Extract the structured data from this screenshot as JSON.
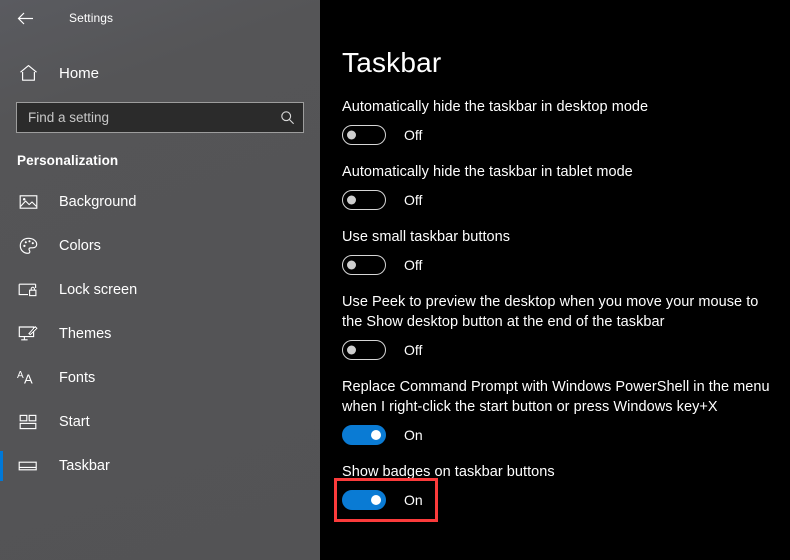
{
  "window": {
    "title": "Settings",
    "back_icon": "back-arrow-icon"
  },
  "sidebar": {
    "home": {
      "label": "Home",
      "icon": "home-icon"
    },
    "search": {
      "placeholder": "Find a setting",
      "value": "",
      "icon": "search-icon"
    },
    "section_heading": "Personalization",
    "accent_color": "#0078d7",
    "items": [
      {
        "label": "Background",
        "icon": "image-icon",
        "selected": false
      },
      {
        "label": "Colors",
        "icon": "palette-icon",
        "selected": false
      },
      {
        "label": "Lock screen",
        "icon": "lock-screen-icon",
        "selected": false
      },
      {
        "label": "Themes",
        "icon": "themes-icon",
        "selected": false
      },
      {
        "label": "Fonts",
        "icon": "fonts-icon",
        "selected": false
      },
      {
        "label": "Start",
        "icon": "start-tiles-icon",
        "selected": false
      },
      {
        "label": "Taskbar",
        "icon": "taskbar-icon",
        "selected": true
      }
    ]
  },
  "main": {
    "title": "Taskbar",
    "toggle_on_color": "#0a7bd4",
    "highlight_color": "#fb3b3b",
    "settings": [
      {
        "label": "Automatically hide the taskbar in desktop mode",
        "state": "Off",
        "on": false,
        "highlighted": false
      },
      {
        "label": "Automatically hide the taskbar in tablet mode",
        "state": "Off",
        "on": false,
        "highlighted": false
      },
      {
        "label": "Use small taskbar buttons",
        "state": "Off",
        "on": false,
        "highlighted": false
      },
      {
        "label": "Use Peek to preview the desktop when you move your mouse to the Show desktop button at the end of the taskbar",
        "state": "Off",
        "on": false,
        "highlighted": false
      },
      {
        "label": "Replace Command Prompt with Windows PowerShell in the menu when I right-click the start button or press Windows key+X",
        "state": "On",
        "on": true,
        "highlighted": false
      },
      {
        "label": "Show badges on taskbar buttons",
        "state": "On",
        "on": true,
        "highlighted": true
      }
    ]
  }
}
